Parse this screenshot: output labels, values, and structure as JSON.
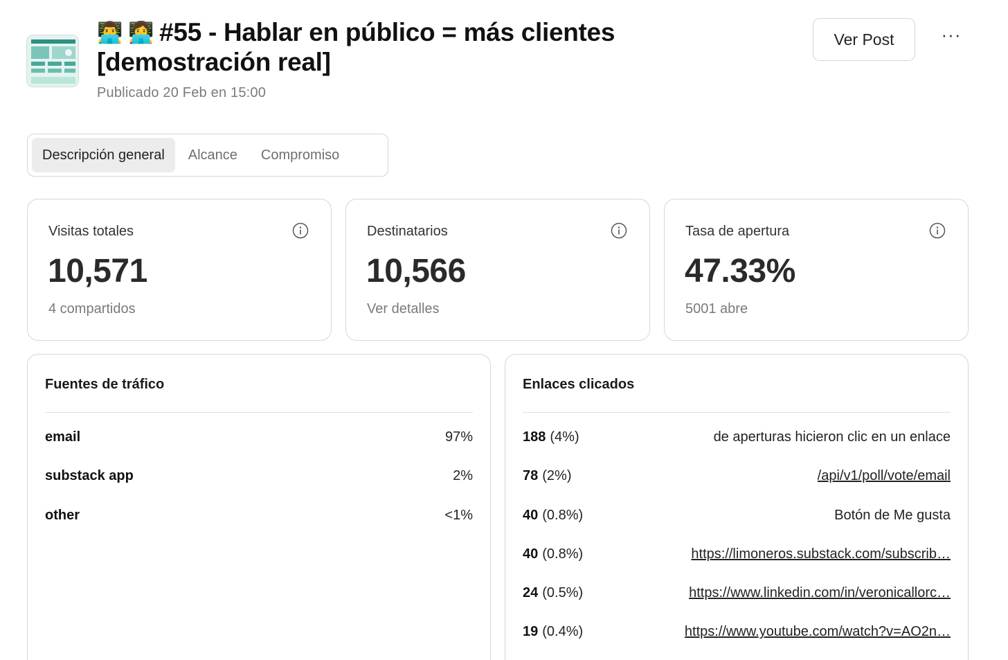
{
  "post": {
    "emojis": "👨‍💻 👩‍💻",
    "title": "#55 - Hablar en público = más clientes [demostración real]",
    "published": "Publicado 20 Feb en 15:00",
    "ver_post_label": "Ver Post",
    "more_label": "···",
    "thumbnail_icon": "post-thumbnail"
  },
  "tabs": [
    {
      "label": "Descripción general",
      "active": true
    },
    {
      "label": "Alcance",
      "active": false
    },
    {
      "label": "Compromiso",
      "active": false
    }
  ],
  "stats": [
    {
      "label": "Visitas totales",
      "value": "10,571",
      "sub": "4 compartidos"
    },
    {
      "label": "Destinatarios",
      "value": "10,566",
      "sub": "Ver detalles"
    },
    {
      "label": "Tasa de apertura",
      "value": "47.33%",
      "sub": "5001 abre"
    }
  ],
  "traffic": {
    "title": "Fuentes de tráfico",
    "rows": [
      {
        "source": "email",
        "pct": "97%"
      },
      {
        "source": "substack app",
        "pct": "2%"
      },
      {
        "source": "other",
        "pct": "<1%"
      }
    ]
  },
  "links": {
    "title": "Enlaces clicados",
    "rows": [
      {
        "count": "188",
        "pct": "(4%)",
        "target": "de aperturas hicieron clic en un enlace",
        "is_link": false
      },
      {
        "count": "78",
        "pct": "(2%)",
        "target": "/api/v1/poll/vote/email",
        "is_link": true
      },
      {
        "count": "40",
        "pct": "(0.8%)",
        "target": "Botón de Me gusta",
        "is_link": false
      },
      {
        "count": "40",
        "pct": "(0.8%)",
        "target": "https://limoneros.substack.com/subscrib…",
        "is_link": true
      },
      {
        "count": "24",
        "pct": "(0.5%)",
        "target": "https://www.linkedin.com/in/veronicallorc…",
        "is_link": true
      },
      {
        "count": "19",
        "pct": "(0.4%)",
        "target": "https://www.youtube.com/watch?v=AO2n…",
        "is_link": true
      }
    ]
  },
  "colors": {
    "border": "#d6d6d6",
    "active_tab_bg": "#ececec",
    "muted_text": "#7a7a7a"
  }
}
